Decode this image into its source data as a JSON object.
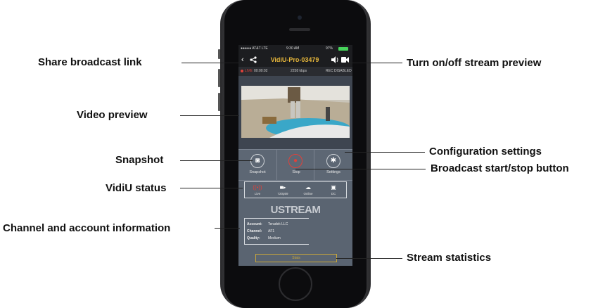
{
  "callouts": {
    "share": "Share broadcast link",
    "video": "Video preview",
    "snapshot": "Snapshot",
    "vidiu_status": "VidiU status",
    "channel_info": "Channel and account information",
    "turn_preview": "Turn on/off stream preview",
    "config": "Configuration settings",
    "broadcast": "Broadcast start/stop button",
    "stream_stats": "Stream statistics"
  },
  "phone": {
    "status_bar": {
      "carrier": "●●●●● AT&T  LTE",
      "time": "9:30 AM",
      "battery": "97%"
    },
    "title": "VidiU-Pro-03479",
    "info_bar": {
      "live_label": "LIVE",
      "elapsed": "00:00:02",
      "bitrate": "2258 kbps",
      "rec_status": "REC DISABLED"
    },
    "controls": [
      {
        "label": "Snapshot",
        "icon": "camera-icon"
      },
      {
        "label": "Stop",
        "icon": "record-icon"
      },
      {
        "label": "Settings",
        "icon": "gear-icon"
      }
    ],
    "status_items": [
      {
        "label": "Live",
        "icon": "broadcast-icon"
      },
      {
        "label": "720p59",
        "icon": "video-camera-icon"
      },
      {
        "label": "Online",
        "icon": "cloud-icon"
      },
      {
        "label": "DC",
        "icon": "power-plug-icon"
      }
    ],
    "platform": "USTREAM",
    "account": {
      "account_label": "Account:",
      "account_value": "Teradek LLC",
      "channel_label": "Channel:",
      "channel_value": "AF1",
      "quality_label": "Quality:",
      "quality_value": "Medium"
    },
    "stats_button": "Stats"
  },
  "colors": {
    "accent": "#e7b73b",
    "record": "#e0413a",
    "screen_bg": "#5a6471"
  }
}
